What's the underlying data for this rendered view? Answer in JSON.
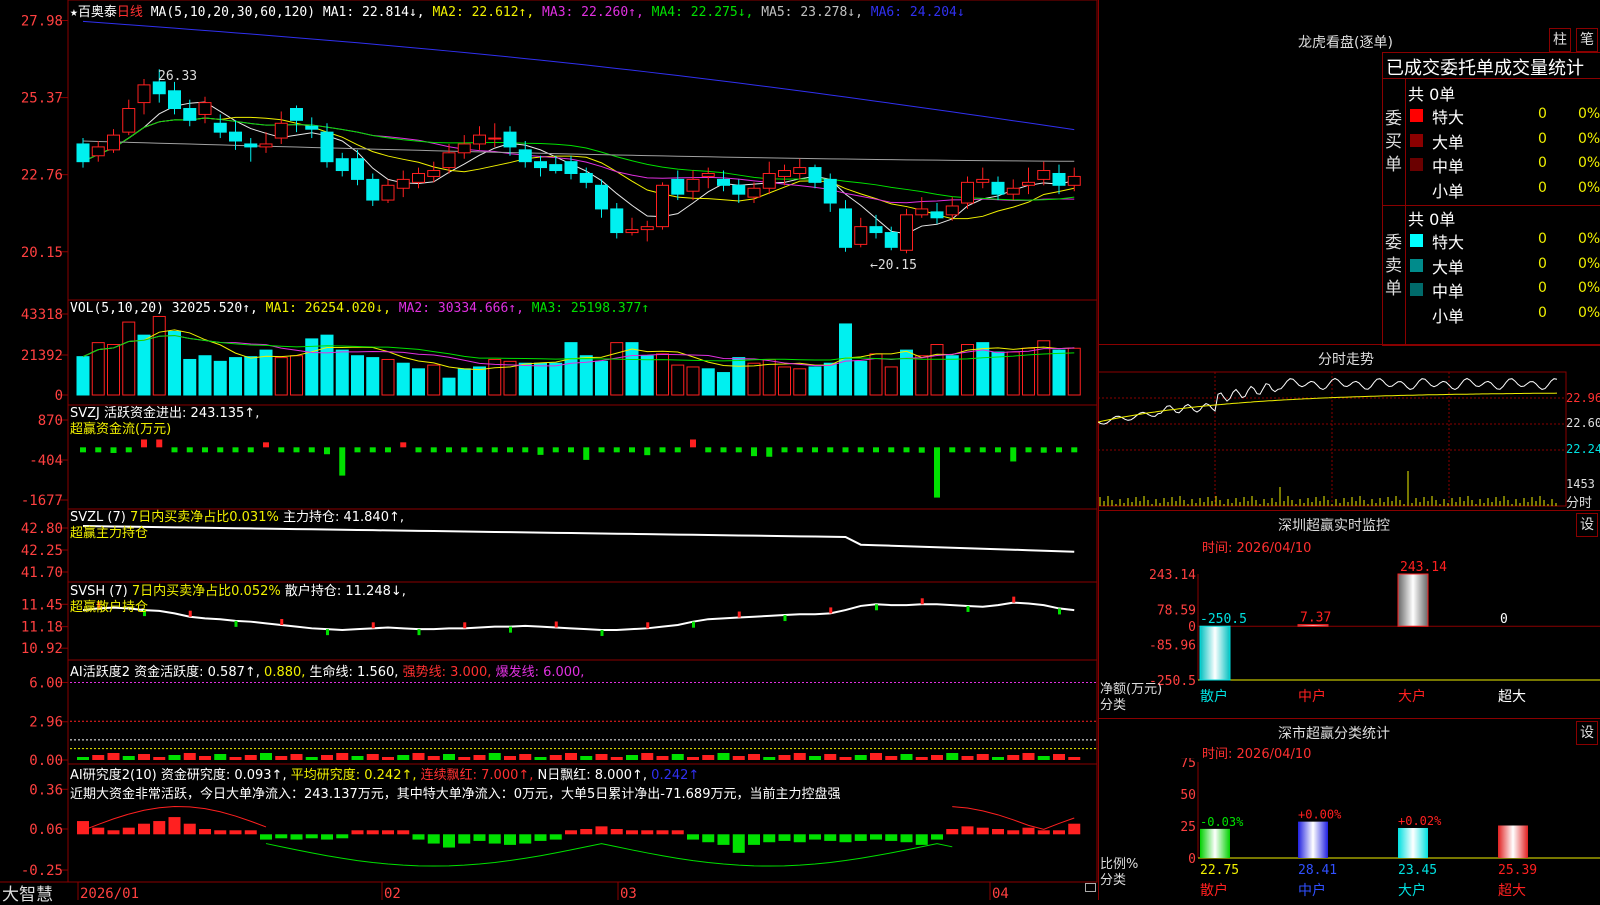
{
  "colors": {
    "up": "#ff2020",
    "down": "#00f0f0",
    "grid": "#8a0000",
    "axis_text": "#ff4040",
    "white": "#e8e8e8",
    "yellow": "#f0f000",
    "magenta": "#e030e0",
    "green": "#00e000",
    "blue": "#3030f0",
    "cyan": "#00c0c0"
  },
  "header": {
    "star": "★",
    "stock_name": "百奥泰",
    "period": "日线",
    "ma_def": "MA(5,10,20,30,60,120)",
    "ma1": "MA1: 22.814↓,",
    "ma2": "MA2: 22.612↑,",
    "ma3": "MA3: 22.260↑,",
    "ma4": "MA4: 22.275↓,",
    "ma5": "MA5: 23.278↓,",
    "ma6": "MA6: 24.204↓"
  },
  "footer": {
    "brand": "大智慧",
    "lock_icon": "lock-icon"
  },
  "chart_data": [
    {
      "id": "kline",
      "type": "candlestick",
      "title": "百奥泰 日线 MA(5,10,20,30,60,120)",
      "yticks": [
        "27.98",
        "25.37",
        "22.76",
        "20.15"
      ],
      "ylim": [
        19.6,
        28.2
      ],
      "annotations": [
        "26.33",
        "←20.15"
      ],
      "candles": [
        [
          23.8,
          23.2,
          24.0,
          23.0
        ],
        [
          23.4,
          23.7,
          23.9,
          23.2
        ],
        [
          23.6,
          24.1,
          24.3,
          23.5
        ],
        [
          24.2,
          25.0,
          25.3,
          24.1
        ],
        [
          25.2,
          25.8,
          26.0,
          24.8
        ],
        [
          25.9,
          25.5,
          26.33,
          25.2
        ],
        [
          25.6,
          25.0,
          25.9,
          24.8
        ],
        [
          25.0,
          24.6,
          25.3,
          24.4
        ],
        [
          24.8,
          25.2,
          25.4,
          24.5
        ],
        [
          24.5,
          24.2,
          24.8,
          24.0
        ],
        [
          24.2,
          23.9,
          24.6,
          23.6
        ],
        [
          23.8,
          23.7,
          24.0,
          23.2
        ],
        [
          23.7,
          23.8,
          24.2,
          23.5
        ],
        [
          24.0,
          24.5,
          24.9,
          23.8
        ],
        [
          25.0,
          24.6,
          25.1,
          24.2
        ],
        [
          24.4,
          24.3,
          24.7,
          24.0
        ],
        [
          24.2,
          23.2,
          24.5,
          23.0
        ],
        [
          23.3,
          22.9,
          23.5,
          22.7
        ],
        [
          23.3,
          22.6,
          23.6,
          22.4
        ],
        [
          22.6,
          21.9,
          22.8,
          21.7
        ],
        [
          21.9,
          22.4,
          22.6,
          21.8
        ],
        [
          22.3,
          22.6,
          22.9,
          22.0
        ],
        [
          22.5,
          22.8,
          23.0,
          22.3
        ],
        [
          22.7,
          22.9,
          23.2,
          22.5
        ],
        [
          23.0,
          23.5,
          23.8,
          22.8
        ],
        [
          23.5,
          23.8,
          24.1,
          23.3
        ],
        [
          23.8,
          24.1,
          24.4,
          23.6
        ],
        [
          24.0,
          24.0,
          24.5,
          23.7
        ],
        [
          24.2,
          23.7,
          24.4,
          23.4
        ],
        [
          23.6,
          23.2,
          23.9,
          23.0
        ],
        [
          23.2,
          23.0,
          23.4,
          22.7
        ],
        [
          23.1,
          22.9,
          23.4,
          22.8
        ],
        [
          23.2,
          22.8,
          23.4,
          22.6
        ],
        [
          22.8,
          22.5,
          23.0,
          22.3
        ],
        [
          22.4,
          21.6,
          22.6,
          21.3
        ],
        [
          21.6,
          20.8,
          21.8,
          20.6
        ],
        [
          20.8,
          20.9,
          21.3,
          20.7
        ],
        [
          20.9,
          21.0,
          21.2,
          20.5
        ],
        [
          21.0,
          22.4,
          22.5,
          20.9
        ],
        [
          22.6,
          22.1,
          22.9,
          21.9
        ],
        [
          22.2,
          22.6,
          22.9,
          21.9
        ],
        [
          22.7,
          22.8,
          23.0,
          22.3
        ],
        [
          22.6,
          22.4,
          22.9,
          22.2
        ],
        [
          22.4,
          22.1,
          22.6,
          21.8
        ],
        [
          22.0,
          22.3,
          22.5,
          21.8
        ],
        [
          22.3,
          22.8,
          23.2,
          22.1
        ],
        [
          22.7,
          22.9,
          23.1,
          22.4
        ],
        [
          22.8,
          23.0,
          23.3,
          22.6
        ],
        [
          23.0,
          22.5,
          23.1,
          22.3
        ],
        [
          22.6,
          21.8,
          22.8,
          21.5
        ],
        [
          21.6,
          20.3,
          21.9,
          20.15
        ],
        [
          20.4,
          21.0,
          21.3,
          20.3
        ],
        [
          21.0,
          20.8,
          21.4,
          20.6
        ],
        [
          20.8,
          20.3,
          21.0,
          20.2
        ],
        [
          20.2,
          21.4,
          21.6,
          20.1
        ],
        [
          21.4,
          21.6,
          22.0,
          21.3
        ],
        [
          21.5,
          21.3,
          21.8,
          21.1
        ],
        [
          21.4,
          21.7,
          22.0,
          21.2
        ],
        [
          21.8,
          22.5,
          22.7,
          21.6
        ],
        [
          22.5,
          22.6,
          23.0,
          22.3
        ],
        [
          22.5,
          22.1,
          22.7,
          21.9
        ],
        [
          22.1,
          22.3,
          22.6,
          21.9
        ],
        [
          22.4,
          22.5,
          23.0,
          22.1
        ],
        [
          22.6,
          22.9,
          23.2,
          22.4
        ],
        [
          22.8,
          22.4,
          23.1,
          22.1
        ],
        [
          22.4,
          22.7,
          23.0,
          22.2
        ]
      ]
    },
    {
      "id": "vol",
      "type": "bar",
      "title": "VOL(5,10,20)",
      "yticks": [
        "43318",
        "21392",
        "0"
      ],
      "ylim": [
        0,
        43318
      ],
      "legend": [
        "VOL(5,10,20)",
        "32025.520↑,",
        "MA1: 26254.020↓,",
        "MA2: 30334.666↑,",
        "MA3: 25198.377↑"
      ],
      "values": [
        20500,
        28000,
        27000,
        39000,
        32000,
        42000,
        34000,
        19000,
        21000,
        18000,
        20000,
        20500,
        24000,
        20000,
        21000,
        30000,
        32000,
        24000,
        21000,
        20000,
        19000,
        17000,
        14000,
        16000,
        9000,
        14000,
        15000,
        19000,
        18000,
        17000,
        17000,
        17000,
        28000,
        21000,
        18000,
        28000,
        28000,
        21000,
        22000,
        16000,
        15000,
        14000,
        12000,
        20000,
        17000,
        19000,
        15000,
        14000,
        15000,
        17000,
        38000,
        18000,
        22000,
        15000,
        24000,
        21000,
        27000,
        21000,
        27000,
        28000,
        23000,
        23000,
        25000,
        29000,
        24000,
        25000
      ],
      "colors": [
        "c",
        "u",
        "u",
        "u",
        "c",
        "u",
        "c",
        "c",
        "c",
        "c",
        "c",
        "c",
        "c",
        "u",
        "u",
        "c",
        "c",
        "c",
        "c",
        "c",
        "u",
        "c",
        "c",
        "u",
        "c",
        "c",
        "c",
        "u",
        "u",
        "c",
        "c",
        "c",
        "c",
        "c",
        "c",
        "u",
        "c",
        "c",
        "u",
        "u",
        "u",
        "c",
        "c",
        "c",
        "u",
        "u",
        "u",
        "u",
        "c",
        "c",
        "c",
        "c",
        "u",
        "u",
        "c",
        "u",
        "u",
        "c",
        "u",
        "c",
        "c",
        "u",
        "u",
        "u",
        "c",
        "u"
      ]
    },
    {
      "id": "svzj",
      "type": "bar",
      "title": "SVZJ 活跃资金进出",
      "yticks": [
        "870",
        "-404",
        "-1677"
      ],
      "ylim": [
        -1677,
        870
      ],
      "legend": [
        "SVZJ",
        "活跃资金进出: 243.135↑,",
        "超赢资金流(万元)"
      ],
      "values": [
        0,
        0,
        -180,
        0,
        250,
        250,
        -120,
        0,
        -80,
        -70,
        0,
        0,
        150,
        0,
        -120,
        0,
        -220,
        -900,
        0,
        -120,
        0,
        150,
        0,
        0,
        -160,
        0,
        -100,
        -100,
        -120,
        -150,
        -240,
        -120,
        0,
        -400,
        -150,
        -120,
        0,
        -250,
        0,
        -130,
        250,
        -130,
        -110,
        0,
        -280,
        -300,
        0,
        -120,
        -90,
        -120,
        0,
        -90,
        -80,
        -120,
        -120,
        -170,
        -1600,
        -110,
        0,
        -150,
        -120,
        -450,
        -100,
        -170,
        -100,
        -90
      ]
    },
    {
      "id": "svzl",
      "type": "line",
      "title": "SVZL (7) 7日内买卖净占比0.031% 主力持仓",
      "yticks": [
        "42.80",
        "42.25",
        "41.70"
      ],
      "ylim": [
        41.6,
        42.9
      ],
      "legend": [
        "SVZL (7)",
        "7日内买卖净占比0.031%",
        "主力持仓: 41.840↑,",
        "超赢主力持仓"
      ]
    },
    {
      "id": "svsh",
      "type": "line",
      "title": "SVSH (7) 7日内买卖净占比0.052% 散户持仓",
      "yticks": [
        "11.45",
        "11.18",
        "10.92"
      ],
      "ylim": [
        10.85,
        11.55
      ],
      "legend": [
        "SVSH (7)",
        "7日内买卖净占比0.052%",
        "散户持仓: 11.248↓,",
        "超赢散户持仓"
      ]
    },
    {
      "id": "ai_active",
      "type": "bar",
      "title": "AI活跃度2",
      "yticks": [
        "6.00",
        "2.96",
        "0.00"
      ],
      "ylim": [
        0,
        6.5
      ],
      "legend": [
        "AI活跃度2",
        "资金活跃度: 0.587↑,",
        "0.880,",
        "生命线: 1.560,",
        "强势线: 3.000,",
        "爆发线: 6.000,"
      ]
    },
    {
      "id": "ai_research",
      "type": "bar",
      "title": "AI研究度2(10)",
      "yticks": [
        "0.36",
        "0.06",
        "-0.25"
      ],
      "ylim": [
        -0.28,
        0.4
      ],
      "legend": [
        "AI研究度2(10)",
        "资金研究度: 0.093↑,",
        "平均研究度: 0.242↑,",
        "连续飘红: 7.000↑,",
        "N日飘红: 8.000↑,",
        "0.242↑"
      ],
      "note": "近期大资金非常活跃，今日大单净流入：243.137万元，其中特大单净流入：0万元，大单5日累计净出-71.689万元，当前主力控盘强"
    },
    {
      "id": "sz_monitor",
      "type": "bar",
      "title": "深圳超赢实时监控",
      "date": "时间: 2026/04/10",
      "yticks": [
        "243.14",
        "78.59",
        "0",
        "-85.96",
        "-250.5"
      ],
      "ylim": [
        -250.5,
        243.14
      ],
      "ylabel": "净额(万元)",
      "xlabel": "分类",
      "categories": [
        "散户",
        "中户",
        "大户",
        "超大"
      ],
      "values": [
        -250.5,
        7.37,
        243.14,
        0
      ],
      "value_labels": [
        "-250.5",
        "7.37",
        "243.14",
        "0"
      ]
    },
    {
      "id": "sz_class",
      "type": "bar",
      "title": "深市超赢分类统计",
      "date": "时间: 2026/04/10",
      "yticks": [
        "75",
        "50",
        "25",
        "0"
      ],
      "ylim": [
        0,
        75
      ],
      "ylabel": "比例%",
      "xlabel": "分类",
      "categories": [
        "散户",
        "中户",
        "大户",
        "超大"
      ],
      "values": [
        22.75,
        28.41,
        23.45,
        25.39
      ],
      "change_labels": [
        "-0.03%",
        "+0.00%",
        "+0.02%",
        ""
      ]
    }
  ],
  "xaxis": {
    "labels": [
      "2026/01",
      "02",
      "03",
      "04"
    ]
  },
  "longhu": {
    "title": "龙虎看盘(逐单)",
    "btn_zhu": "柱",
    "btn_bi": "笔",
    "table_title": "已成交委托单成交量统计",
    "buy_label": "委买单",
    "sell_label": "委卖单",
    "buy_total": "共 0单",
    "sell_total": "共 0单",
    "buy_rows": [
      {
        "name": "特大",
        "count": "0",
        "pct": "0%",
        "color": "#ff0000"
      },
      {
        "name": "大单",
        "count": "0",
        "pct": "0%",
        "color": "#8b0000"
      },
      {
        "name": "中单",
        "count": "0",
        "pct": "0%",
        "color": "#6a0000"
      },
      {
        "name": "小单",
        "count": "0",
        "pct": "0%",
        "color": ""
      }
    ],
    "sell_rows": [
      {
        "name": "特大",
        "count": "0",
        "pct": "0%",
        "color": "#00ffff"
      },
      {
        "name": "大单",
        "count": "0",
        "pct": "0%",
        "color": "#008b8b"
      },
      {
        "name": "中单",
        "count": "0",
        "pct": "0%",
        "color": "#006a6a"
      },
      {
        "name": "小单",
        "count": "0",
        "pct": "0%",
        "color": ""
      }
    ]
  },
  "intraday": {
    "title": "分时走势",
    "yticks": [
      "22.96",
      "22.60",
      "22.24"
    ],
    "vol_tick": "1453",
    "label": "分时"
  },
  "panels": {
    "setting_btn": "设"
  }
}
